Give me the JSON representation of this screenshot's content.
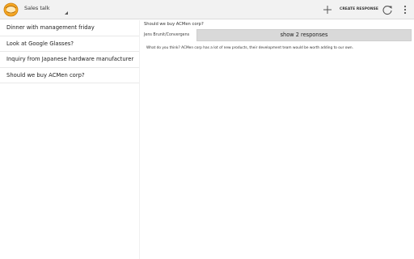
{
  "header": {
    "title": "Sales talk",
    "create_label": "CREATE RESPONSE",
    "icons": [
      "app-logo-icon",
      "add-icon",
      "refresh-icon",
      "overflow-menu-icon"
    ]
  },
  "threads": [
    {
      "label": "Dinner with management friday"
    },
    {
      "label": "Look at Google Glasses?"
    },
    {
      "label": "Inquiry from Japanese hardware manufacturer"
    },
    {
      "label": "Should we buy ACMen corp?"
    }
  ],
  "detail": {
    "title": "Should we buy ACMen corp?",
    "author": "Jens Brunit/Convergens",
    "show_responses_label": "show 2 responses",
    "body": "What do you think? ACMen corp has a lot of new products, their development team would be worth adding to our own."
  },
  "colors": {
    "actionbar_bg": "#f2f2f2",
    "button_bg": "#d9d9d9",
    "logo_orange": "#f5a623"
  }
}
